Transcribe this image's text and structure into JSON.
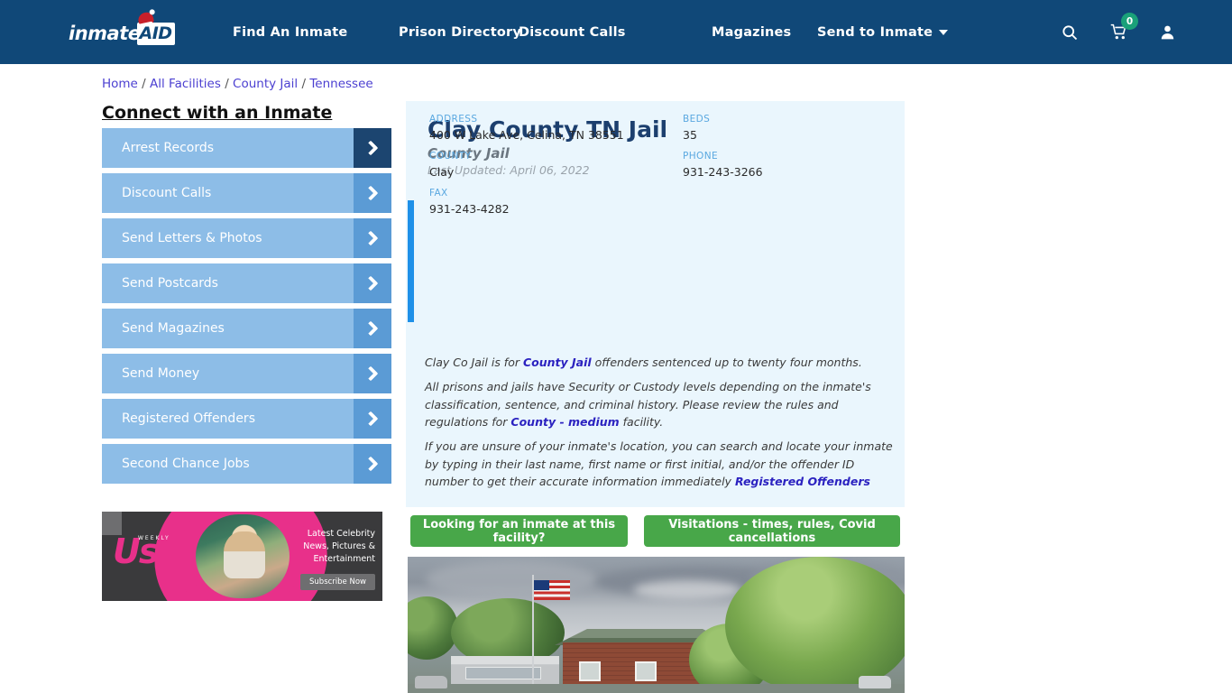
{
  "header": {
    "logo_text": "inmate",
    "logo_badge": "AID",
    "nav": [
      {
        "label": "Find An Inmate",
        "name": "nav-find-an-inmate"
      },
      {
        "label": "Prison Directory",
        "name": "nav-prison-directory"
      },
      {
        "label": "Discount Calls",
        "name": "nav-discount-calls"
      },
      {
        "label": "Magazines",
        "name": "nav-magazines"
      },
      {
        "label": "Send to Inmate",
        "name": "nav-send-to-inmate"
      }
    ],
    "icons": {
      "search": "search-icon",
      "cart": "shopping-cart-icon",
      "cart_count": "0",
      "account": "user-account-icon"
    },
    "bg_color": "#104878",
    "badge_color": "#1aa179"
  },
  "breadcrumb": {
    "items": [
      "Home",
      "All Facilities",
      "County Jail",
      "Tennessee"
    ],
    "separator": "/"
  },
  "sidebar": {
    "title": "Connect with an Inmate",
    "items": [
      {
        "label": "Arrest Records"
      },
      {
        "label": "Discount Calls"
      },
      {
        "label": "Send Letters & Photos"
      },
      {
        "label": "Send Postcards"
      },
      {
        "label": "Send Magazines"
      },
      {
        "label": "Send Money"
      },
      {
        "label": "Registered Offenders"
      },
      {
        "label": "Second Chance Jobs"
      }
    ]
  },
  "ad": {
    "brand": "Us",
    "brand_sub": "WEEKLY",
    "headline": "Latest Celebrity News, Pictures & Entertainment",
    "cta": "Subscribe Now"
  },
  "facility": {
    "title": "Clay County TN Jail",
    "subtitle": "County Jail",
    "last_updated": "Last Updated: April 06, 2022",
    "fields": {
      "address_label": "ADDRESS",
      "address_value": "400 W Lake Ave, Celina, TN 38551",
      "county_label": "COUNTY",
      "county_value": "Clay",
      "fax_label": "FAX",
      "fax_value": "931-243-4282",
      "beds_label": "BEDS",
      "beds_value": "35",
      "phone_label": "PHONE",
      "phone_value": "931-243-3266"
    },
    "paragraphs": {
      "p1_a": "Clay Co Jail is for ",
      "p1_link": "County Jail",
      "p1_b": " offenders sentenced up to twenty four months.",
      "p2_a": "All prisons and jails have Security or Custody levels depending on the inmate's classification, sentence, and criminal history. Please review the rules and regulations for ",
      "p2_link": "County - medium",
      "p2_b": " facility.",
      "p3_a": "If you are unsure of your inmate's location, you can search and locate your inmate by typing in their last name, first name or first initial, and/or the offender ID number to get their accurate information immediately ",
      "p3_link": "Registered Offenders"
    },
    "buttons": {
      "inmate_search": "Looking for an inmate at this facility?",
      "visitations": "Visitations - times, rules, Covid cancellations"
    },
    "photo_alt": "Clay County TN Jail street view photo",
    "accent_color": "#1e90e8",
    "panel_bg": "#eaf6fd",
    "button_color": "#48a749"
  }
}
